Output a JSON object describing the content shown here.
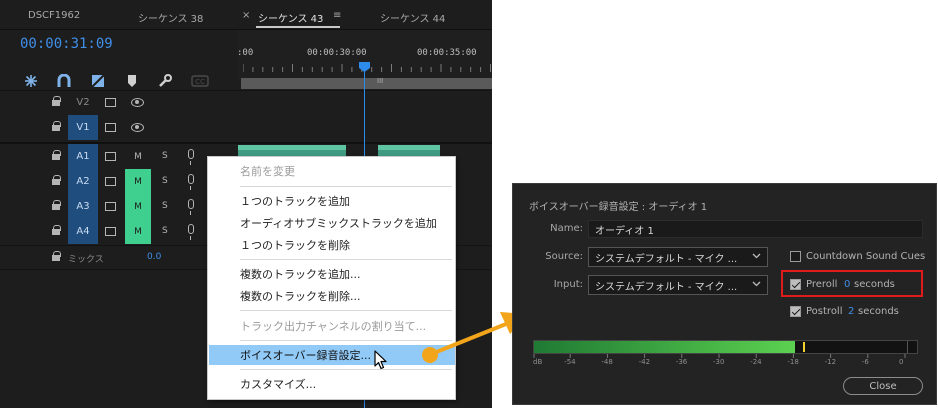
{
  "tabs": [
    {
      "label": "DSCF1962"
    },
    {
      "label": "シーケンス 38"
    },
    {
      "label": "シーケンス 43"
    },
    {
      "label": "シーケンス 44"
    }
  ],
  "tab_close_glyph": "×",
  "tab_menu_glyph": "≡",
  "timecode": "00:00:31:09",
  "ruler": {
    "labels": [
      ":00",
      "00:00:30:00",
      "00:00:35:00"
    ],
    "center_mark": "III"
  },
  "toolbar_icons": [
    "snap-icon",
    "linked-selection-icon",
    "add-marker-icon",
    "marker-icon",
    "wrench-icon",
    "captions-icon"
  ],
  "toolbar_cc": "CC",
  "tracks": [
    {
      "name": "V2",
      "kind": "video",
      "active": false
    },
    {
      "name": "V1",
      "kind": "video",
      "active": true
    },
    {
      "name": "A1",
      "kind": "audio",
      "active": true,
      "mute_on": false
    },
    {
      "name": "A2",
      "kind": "audio",
      "active": true,
      "mute_on": true
    },
    {
      "name": "A3",
      "kind": "audio",
      "active": true,
      "mute_on": true
    },
    {
      "name": "A4",
      "kind": "audio",
      "active": true,
      "mute_on": true
    }
  ],
  "mute_label": "M",
  "solo_label": "S",
  "mix": {
    "label": "ミックス",
    "value": "0.0"
  },
  "context_menu": {
    "items": [
      {
        "label": "名前を変更",
        "disabled": true
      },
      {
        "label": "１つのトラックを追加",
        "disabled": false
      },
      {
        "label": "オーディオサブミックストラックを追加",
        "disabled": false
      },
      {
        "label": "１つのトラックを削除",
        "disabled": false
      },
      {
        "label": "複数のトラックを追加...",
        "disabled": false
      },
      {
        "label": "複数のトラックを削除...",
        "disabled": false
      },
      {
        "label": "トラック出力チャンネルの割り当て...",
        "disabled": true
      },
      {
        "label": "ボイスオーバー録音設定...",
        "disabled": false,
        "selected": true
      },
      {
        "label": "カスタマイズ...",
        "disabled": false
      }
    ]
  },
  "dialog": {
    "title": "ボイスオーバー録音設定 : オーディオ 1",
    "name_label": "Name:",
    "name_value": "オーディオ 1",
    "source_label": "Source:",
    "source_value": "システムデフォルト - マイク ...",
    "input_label": "Input:",
    "input_value": "システムデフォルト - マイク ...",
    "countdown_label": "Countdown Sound Cues",
    "countdown_checked": false,
    "preroll_label": "Preroll",
    "preroll_value": "0",
    "preroll_unit": "seconds",
    "preroll_checked": true,
    "postroll_label": "Postroll",
    "postroll_value": "2",
    "postroll_unit": "seconds",
    "postroll_checked": true,
    "meter_level_fraction": 0.7,
    "meter_scale": [
      "dB",
      "-54",
      "-48",
      "-42",
      "-36",
      "-30",
      "-24",
      "-18",
      "-12",
      "-6",
      "0"
    ],
    "close_label": "Close"
  },
  "colors": {
    "accent_blue": "#3f8fe8",
    "mute_on": "#3fcf8e",
    "track_active": "#1f4d7e",
    "highlight_red": "#e01b1b",
    "arrow_orange": "#f2a51a",
    "menu_selected": "#91c9f7"
  }
}
